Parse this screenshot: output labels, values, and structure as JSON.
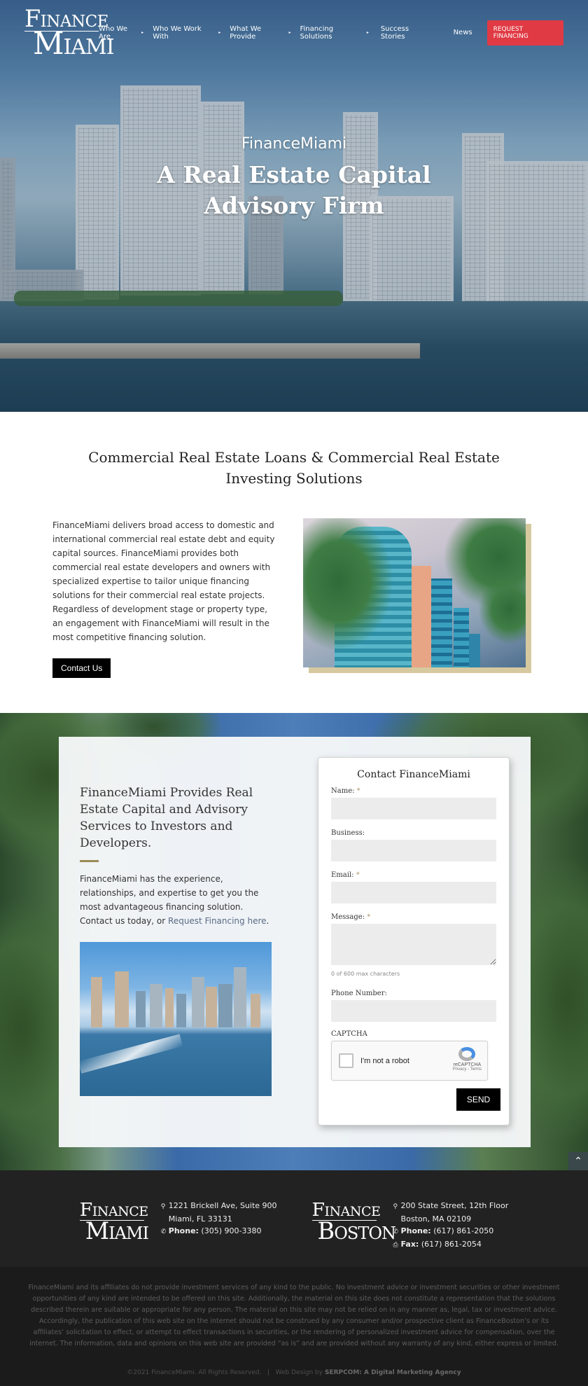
{
  "header": {
    "logo": {
      "line1_initial": "F",
      "line1_rest": "INANCE",
      "line2_initial": "M",
      "line2_rest": "IAMI"
    },
    "nav": [
      {
        "label": "Who We Are",
        "has_submenu": true
      },
      {
        "label": "Who We Work With",
        "has_submenu": true
      },
      {
        "label": "What We Provide",
        "has_submenu": true
      },
      {
        "label": "Financing Solutions",
        "has_submenu": true
      },
      {
        "label": "Success Stories",
        "has_submenu": false
      },
      {
        "label": "News",
        "has_submenu": false
      }
    ],
    "cta_label": "REQUEST FINANCING",
    "cta_color": "#e03a44",
    "caret_icon": "▸"
  },
  "hero": {
    "subtitle": "FinanceMiami",
    "title": "A Real Estate Capital Advisory Firm"
  },
  "intro": {
    "heading": "Commercial Real Estate Loans & Commercial Real Estate Investing Solutions",
    "body": "FinanceMiami delivers broad access to domestic and international commercial real estate debt and equity capital sources. FinanceMiami provides both commercial real estate developers and owners with specialized expertise to tailor unique financing solutions for their commercial real estate projects. Regardless of development stage or property type, an engagement with FinanceMiami will result in the most competitive financing solution.",
    "button_label": "Contact Us",
    "image_alt": "Miami towers with palm trees"
  },
  "cta": {
    "heading": "FinanceMiami Provides Real Estate Capital and Advisory Services to Investors and Developers.",
    "accent_color": "#9a8a55",
    "body_prefix": "FinanceMiami has the experience, relationships, and expertise to get you the most advantageous financing solution. Contact us today, or ",
    "link_label": "Request Financing here",
    "body_suffix": ".",
    "image_alt": "Miami skyline from the water"
  },
  "form": {
    "title": "Contact FinanceMiami",
    "required_marker": "*",
    "fields": {
      "name": {
        "label": "Name:",
        "required": true,
        "value": ""
      },
      "business": {
        "label": "Business:",
        "required": false,
        "value": ""
      },
      "email": {
        "label": "Email:",
        "required": true,
        "value": ""
      },
      "message": {
        "label": "Message:",
        "required": true,
        "value": ""
      },
      "phone": {
        "label": "Phone Number:",
        "required": false,
        "value": ""
      }
    },
    "char_count": "0 of 600 max characters",
    "captcha_label": "CAPTCHA",
    "captcha": {
      "checkbox_label": "I'm not a robot",
      "brand": "reCAPTCHA",
      "links": "Privacy - Terms"
    },
    "submit_label": "SEND"
  },
  "scroll_top_icon": "⌃",
  "footer": {
    "offices": [
      {
        "logo": {
          "line1_initial": "F",
          "line1_rest": "INANCE",
          "line2_initial": "M",
          "line2_rest": "IAMI"
        },
        "address1": "1221 Brickell Ave, Suite 900",
        "address2": "Miami, FL 33131",
        "phone_label": "Phone:",
        "phone": "(305) 900-3380"
      },
      {
        "logo": {
          "line1_initial": "F",
          "line1_rest": "INANCE",
          "line2_initial": "B",
          "line2_rest": "OSTON"
        },
        "address1": "200 State Street, 12th Floor",
        "address2": "Boston, MA 02109",
        "phone_label": "Phone:",
        "phone": "(617) 861-2050",
        "fax_label": "Fax:",
        "fax": "(617) 861-2054"
      }
    ],
    "icons": {
      "location": "⚲",
      "phone": "✆",
      "fax": "⎙"
    },
    "legal": "FinanceMiami and its affiliates do not provide investment services of any kind to the public. No investment advice or investment securities or other investment opportunities of any kind are intended to be offered on this site. Additionally, the material on this site does not constitute a representation that the solutions described therein are suitable or appropriate for any person. The material on this site may not be relied on in any manner as, legal, tax or investment advice. Accordingly, the publication of this web site on the internet should not be construed by any consumer and/or prospective client as FinanceBoston’s or its affiliates’ solicitation to effect, or attempt to effect transactions in securities, or the rendering of personalized investment advice for compensation, over the internet. The information, data and opinions on this web site are provided “as is” and are provided without any warranty of any kind, either express or limited.",
    "copyright": "©2021 FinanceMiami. All Rights Reserved.",
    "separator": "|",
    "credit_prefix": "Web Design by",
    "credit_link": "SERPCOM: A Digital Marketing Agency"
  }
}
